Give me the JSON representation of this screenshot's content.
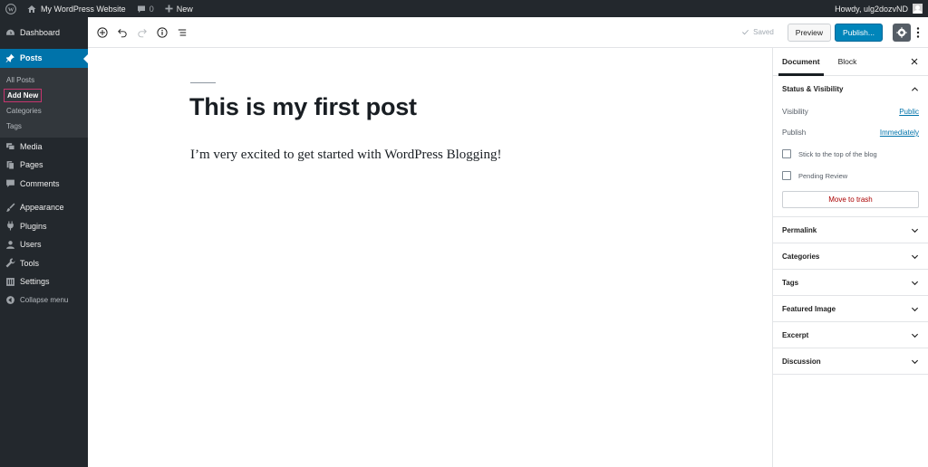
{
  "adminbar": {
    "wp_logo_icon": "wordpress-icon",
    "site_icon": "home-icon",
    "site_name": "My WordPress Website",
    "comments_icon": "comment-icon",
    "comments_count": "0",
    "new_icon": "plus-icon",
    "new_label": "New",
    "howdy": "Howdy, ulg2dozvND"
  },
  "sidebar": {
    "dashboard": "Dashboard",
    "posts": "Posts",
    "submenu": [
      "All Posts",
      "Add New",
      "Categories",
      "Tags"
    ],
    "media": "Media",
    "pages": "Pages",
    "comments": "Comments",
    "appearance": "Appearance",
    "plugins": "Plugins",
    "users": "Users",
    "tools": "Tools",
    "settings": "Settings",
    "collapse": "Collapse menu"
  },
  "toolbar": {
    "saved": "Saved",
    "preview": "Preview",
    "publish": "Publish..."
  },
  "post": {
    "title": "This is my first post",
    "paragraph": "I’m very excited to get started with WordPress Blogging!"
  },
  "settings_panel": {
    "tabs": [
      "Document",
      "Block"
    ],
    "status_title": "Status & Visibility",
    "visibility_label": "Visibility",
    "visibility_value": "Public",
    "publish_label": "Publish",
    "publish_value": "Immediately",
    "stick_label": "Stick to the top of the blog",
    "pending_label": "Pending Review",
    "trash": "Move to trash",
    "panels": [
      "Permalink",
      "Categories",
      "Tags",
      "Featured Image",
      "Excerpt",
      "Discussion"
    ]
  },
  "colors": {
    "admin_dark": "#23282d",
    "admin_blue": "#0073aa",
    "publish_blue": "#0085ba",
    "highlight_box": "#c7356e"
  }
}
